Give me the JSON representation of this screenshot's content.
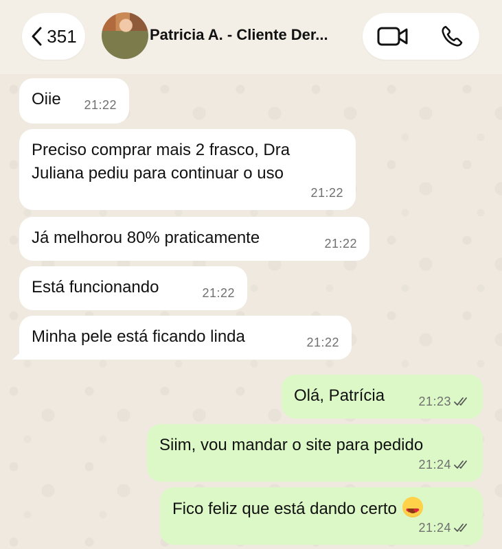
{
  "header": {
    "back_count": "351",
    "contact_name": "Patricia A. - Cliente Der..."
  },
  "messages": [
    {
      "text": "Oiie",
      "time": "21:22",
      "dir": "in"
    },
    {
      "text": "Preciso comprar mais 2 frasco, Dra Juliana pediu para continuar o uso",
      "time": "21:22",
      "dir": "in"
    },
    {
      "text": "Já melhorou 80% praticamente",
      "time": "21:22",
      "dir": "in"
    },
    {
      "text": "Está funcionando",
      "time": "21:22",
      "dir": "in"
    },
    {
      "text": "Minha pele está ficando linda",
      "time": "21:22",
      "dir": "in"
    },
    {
      "text": "Olá, Patrícia",
      "time": "21:23",
      "dir": "out",
      "status": "read"
    },
    {
      "text": "Siim, vou mandar o site para pedido",
      "time": "21:24",
      "dir": "out",
      "status": "read"
    },
    {
      "text": "Fico feliz que está dando certo",
      "time": "21:24",
      "dir": "out",
      "status": "read",
      "emoji": "smiling-face-with-heart-eyes"
    }
  ],
  "colors": {
    "incoming_bubble": "#ffffff",
    "outgoing_bubble": "#dbf8c6",
    "background": "#efe9df"
  }
}
